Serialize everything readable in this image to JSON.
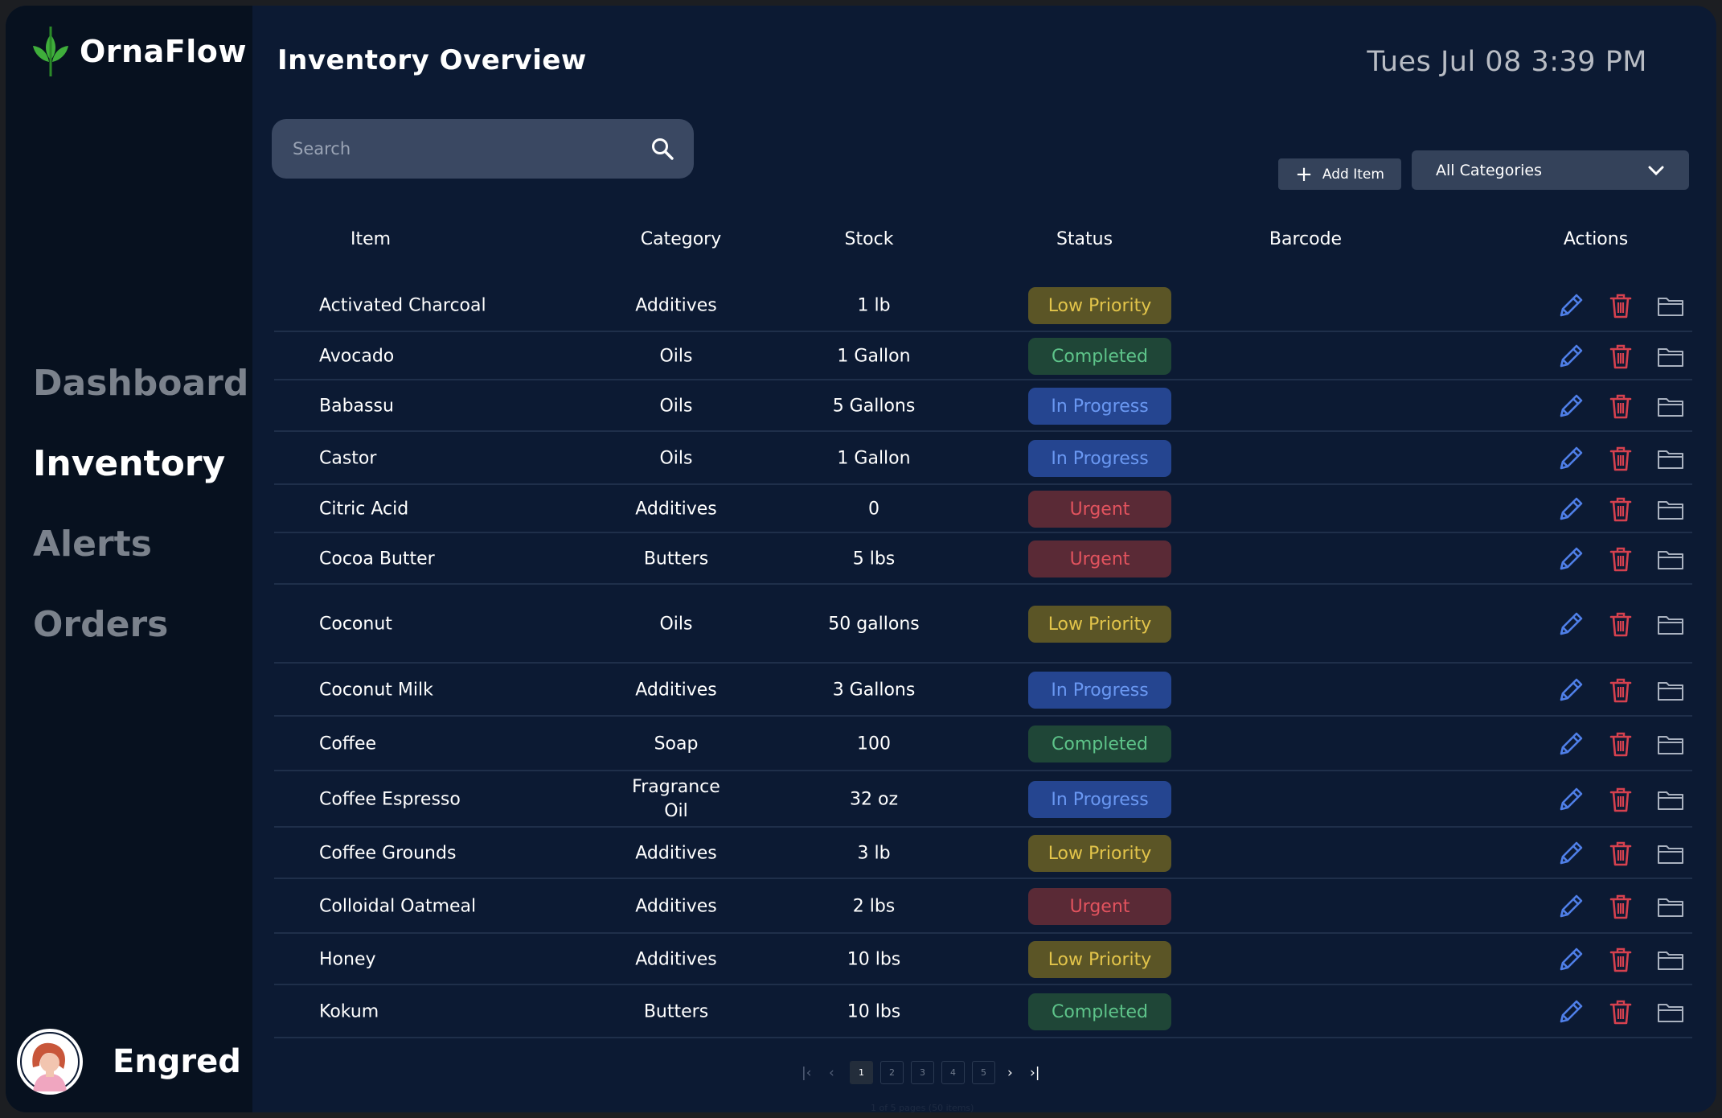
{
  "app": {
    "name": "OrnaFlow"
  },
  "nav": {
    "items": [
      "Dashboard",
      "Inventory",
      "Alerts",
      "Orders"
    ],
    "active": "Inventory"
  },
  "user": {
    "name": "Engred"
  },
  "header": {
    "title": "Inventory Overview",
    "datetime": "Tues Jul 08 3:39 PM"
  },
  "search": {
    "placeholder": "Search"
  },
  "toolbar": {
    "add_label": "Add Item",
    "category_value": "All Categories"
  },
  "table": {
    "columns": [
      "Item",
      "Category",
      "Stock",
      "Status",
      "Barcode",
      "Actions"
    ],
    "rows": [
      {
        "item": "Activated Charcoal",
        "category": "Additives",
        "stock": "1 lb",
        "status": "Low Priority"
      },
      {
        "item": "Avocado",
        "category": "Oils",
        "stock": "1 Gallon",
        "status": "Completed"
      },
      {
        "item": "Babassu",
        "category": "Oils",
        "stock": "5 Gallons",
        "status": "In Progress"
      },
      {
        "item": "Castor",
        "category": "Oils",
        "stock": "1 Gallon",
        "status": "In Progress"
      },
      {
        "item": "Citric Acid",
        "category": "Additives",
        "stock": "0",
        "status": "Urgent"
      },
      {
        "item": "Cocoa Butter",
        "category": "Butters",
        "stock": "5 lbs",
        "status": "Urgent"
      },
      {
        "item": "Coconut",
        "category": "Oils",
        "stock": "50 gallons",
        "status": "Low Priority"
      },
      {
        "item": "Coconut Milk",
        "category": "Additives",
        "stock": "3 Gallons",
        "status": "In Progress"
      },
      {
        "item": "Coffee",
        "category": "Soap",
        "stock": "100",
        "status": "Completed"
      },
      {
        "item": "Coffee Espresso",
        "category": "Fragrance Oil",
        "category_lines": [
          "Fragrance",
          "Oil"
        ],
        "stock": "32 oz",
        "status": "In Progress"
      },
      {
        "item": "Coffee Grounds",
        "category": "Additives",
        "stock": "3 lb",
        "status": "Low Priority"
      },
      {
        "item": "Colloidal Oatmeal",
        "category": "Additives",
        "stock": "2 lbs",
        "status": "Urgent"
      },
      {
        "item": "Honey",
        "category": "Additives",
        "stock": "10 lbs",
        "status": "Low Priority"
      },
      {
        "item": "Kokum",
        "category": "Butters",
        "stock": "10 lbs",
        "status": "Completed"
      }
    ]
  },
  "pagination": {
    "pages": [
      "1",
      "2",
      "3",
      "4",
      "5"
    ],
    "current": "1",
    "info": "1 of 5 pages (50 items)"
  },
  "colors": {
    "background": "#0c1a33",
    "sidebar": "#07111f",
    "brand_green": "#3fae3b",
    "low_priority": "#e2c44a",
    "completed": "#5ec48a",
    "in_progress": "#6a98f2",
    "urgent": "#e2535e",
    "edit_icon": "#4f7fe8",
    "delete_icon": "#d6414f",
    "folder_icon": "#aab2c0"
  },
  "icons": {
    "logo": "leaf-icon",
    "search": "search-icon",
    "add": "plus-icon",
    "dropdown": "chevron-down-icon",
    "edit": "pencil-icon",
    "delete": "trash-icon",
    "folder": "folder-icon"
  }
}
